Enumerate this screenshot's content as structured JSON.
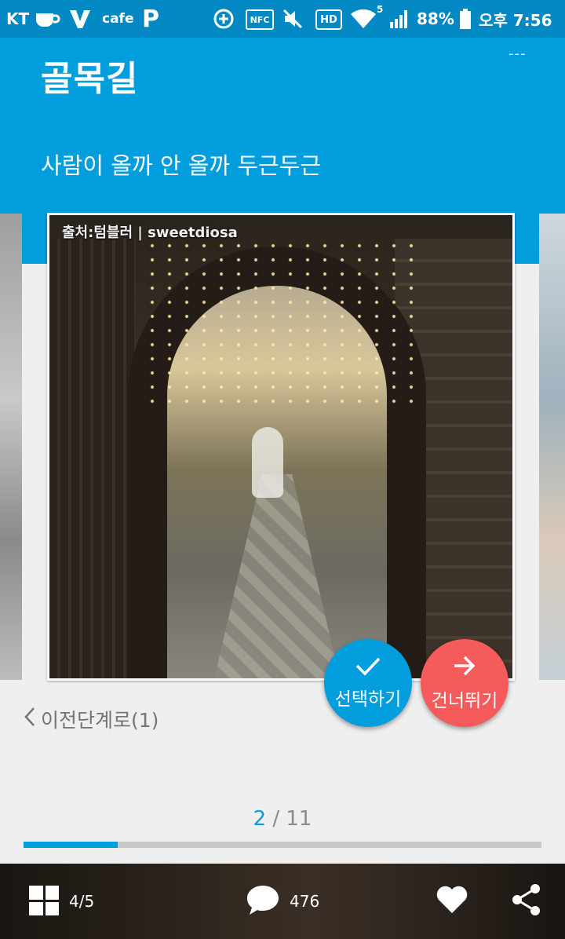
{
  "status_bar": {
    "carrier": "KT",
    "cafe_label": "cafe",
    "p_label": "P",
    "nfc_label": "NFC",
    "hd_label": "HD",
    "wifi_badge": "5",
    "battery": "88%",
    "time": "오후 7:56"
  },
  "header": {
    "title": "골목길",
    "subtitle": "사람이 올까 안 올까 두근두근",
    "menu_label": "---"
  },
  "card": {
    "caption": "출처:텀블러 | sweetdiosa"
  },
  "actions": {
    "select_label": "선택하기",
    "skip_label": "건너뛰기",
    "select_icon": "check-icon",
    "skip_icon": "arrow-right-icon"
  },
  "prev_step_label": "이전단계로(1)",
  "pager": {
    "current": "2",
    "separator": " / ",
    "total": "11",
    "progress": 0.182
  },
  "bottom_bar": {
    "pages": "4/5",
    "comments": "476"
  },
  "colors": {
    "accent": "#029ddc",
    "status_bar": "#0289c4",
    "skip": "#f45b5a"
  }
}
